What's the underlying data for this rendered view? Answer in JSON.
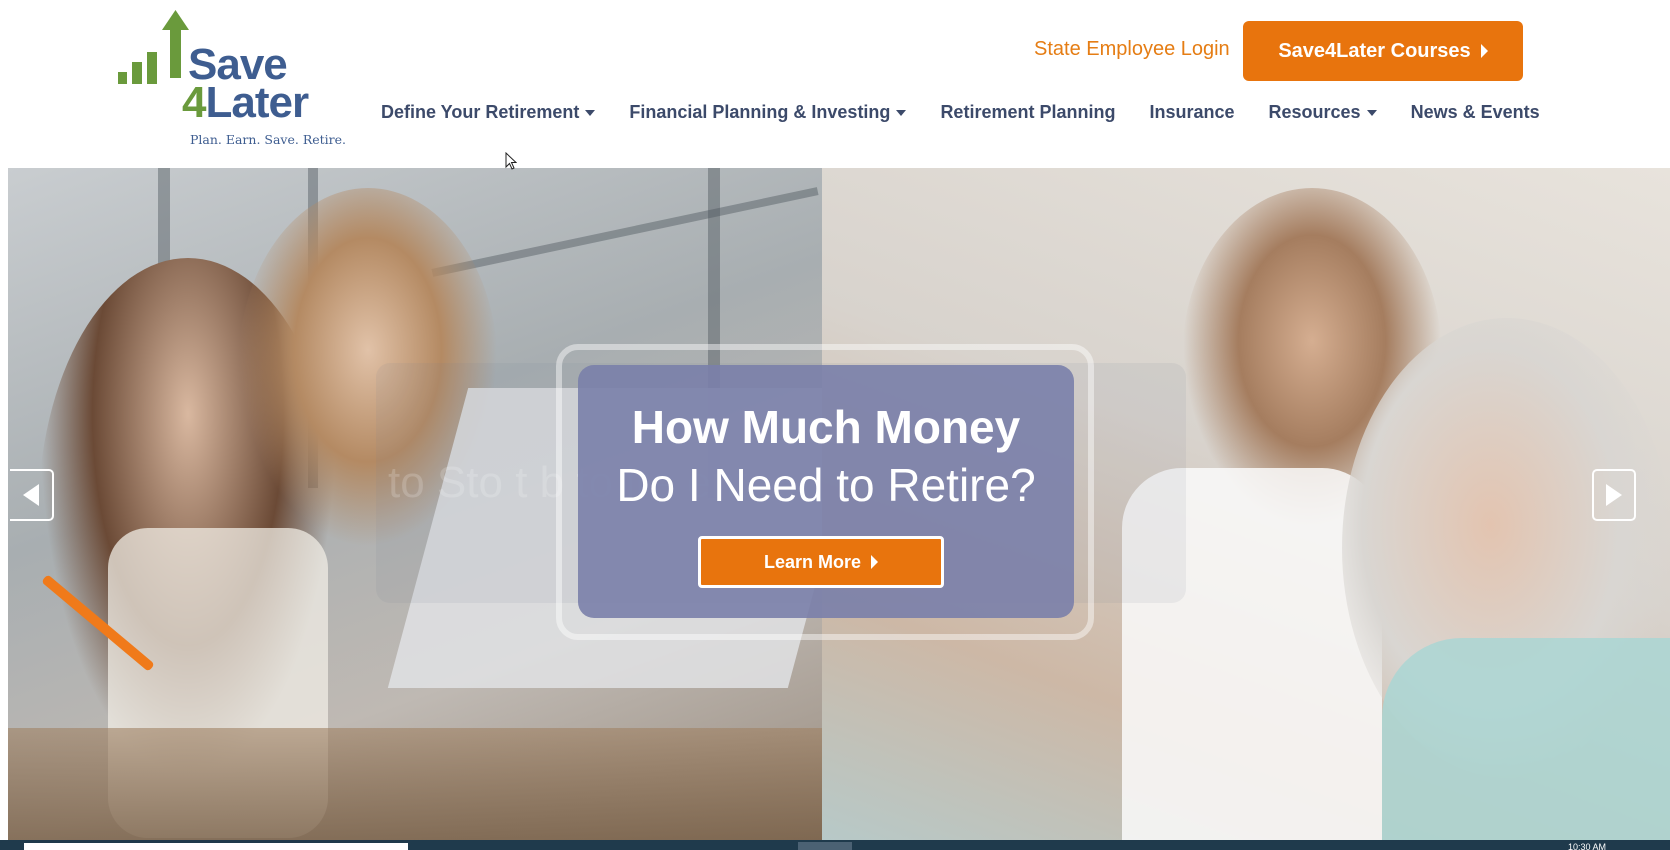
{
  "logo": {
    "name_line1": "Save",
    "name_digit": "4",
    "name_line2": "Later",
    "tagline": "Plan. Earn. Save. Retire.",
    "brand_green": "#6a9a3c",
    "brand_blue": "#3e5d90"
  },
  "header": {
    "login_link": "State Employee Login",
    "courses_button": "Save4Later Courses",
    "accent_color": "#e8740d"
  },
  "nav": {
    "items": [
      {
        "label": "Define Your Retirement",
        "dropdown": true
      },
      {
        "label": "Financial Planning & Investing",
        "dropdown": true
      },
      {
        "label": "Retirement Planning",
        "dropdown": false
      },
      {
        "label": "Insurance",
        "dropdown": false
      },
      {
        "label": "Resources",
        "dropdown": true
      },
      {
        "label": "News & Events",
        "dropdown": false
      }
    ]
  },
  "hero": {
    "headline_bold": "How Much Money",
    "headline_regular": "Do I Need to Retire?",
    "cta_label": "Learn More",
    "ghost_text": "to Sto  t    b         to    ire  ent",
    "prev_icon": "chevron-left-icon",
    "next_icon": "chevron-right-icon"
  },
  "taskbar": {
    "clock": "10:30 AM"
  }
}
